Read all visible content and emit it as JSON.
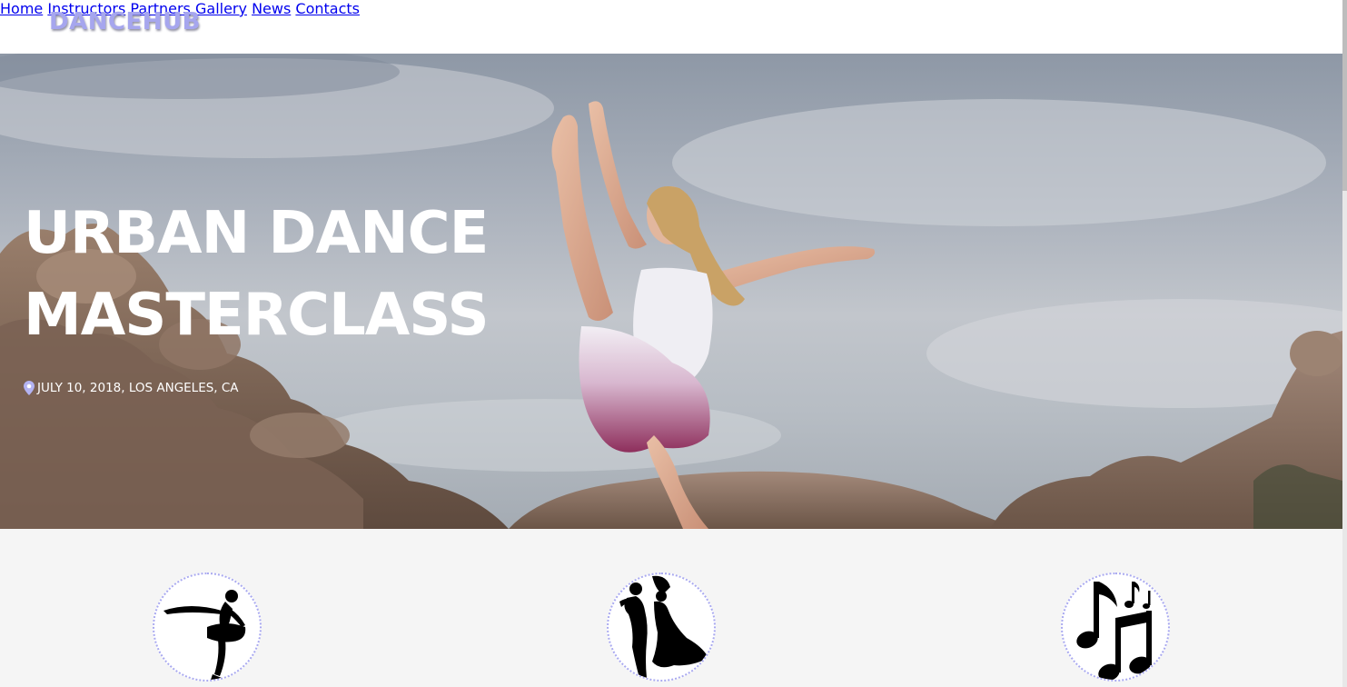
{
  "brand": {
    "logo_text": "DANCEHUB",
    "accent_color": "#a6a6ee"
  },
  "nav": {
    "items": [
      {
        "label": "Home"
      },
      {
        "label": "Instructors"
      },
      {
        "label": "Partners"
      },
      {
        "label": "Gallery"
      },
      {
        "label": "News"
      },
      {
        "label": "Contacts"
      }
    ]
  },
  "hero": {
    "title_line1": "URBAN DANCE",
    "title_line2": "MASTERCLASS",
    "meta_icon": "map-pin-icon",
    "meta_text": "JULY 10, 2018, LOS ANGELES, CA"
  },
  "features": {
    "icons": [
      {
        "icon": "ballerina-icon"
      },
      {
        "icon": "dancing-couple-icon"
      },
      {
        "icon": "music-notes-icon"
      }
    ]
  }
}
